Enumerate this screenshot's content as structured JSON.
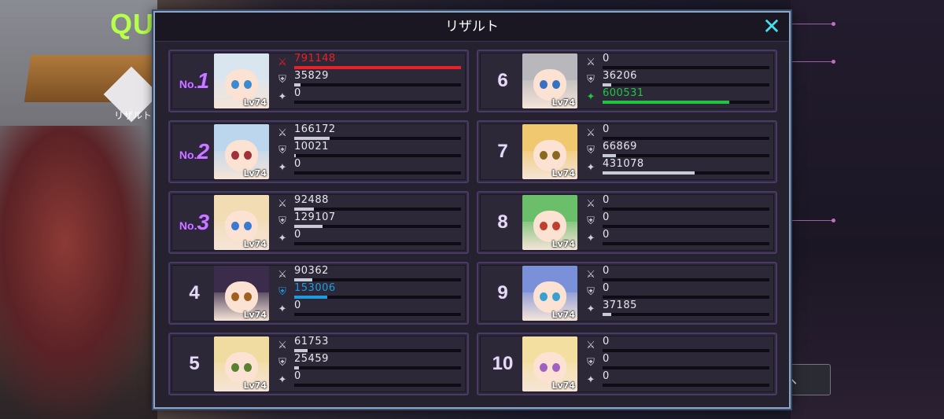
{
  "background": {
    "quest_title": "QU",
    "result_label": "リザルト",
    "next_button": "へ"
  },
  "modal": {
    "title": "リザルト",
    "close_symbol": "✕"
  },
  "colors": {
    "damage_top": "#e8202a",
    "heal_top": "#21c443",
    "guard_top": "#1e9ce0",
    "bar_default": "#c9cad7",
    "rank_top": "#c77cff",
    "close": "#46e0e8"
  },
  "stat_icons": [
    "sword-icon",
    "shield-icon",
    "sparkle-icon"
  ],
  "players": [
    {
      "rank": "1",
      "top": true,
      "level": "Lv74",
      "hair": "#d9e6ef",
      "eyes": "#3c8ad0",
      "stats": [
        {
          "value": "791148",
          "fill": 1.0,
          "highlight": "damage"
        },
        {
          "value": "35829",
          "fill": 0.04
        },
        {
          "value": "0",
          "fill": 0
        }
      ]
    },
    {
      "rank": "2",
      "top": true,
      "level": "Lv74",
      "hair": "#bcd6ee",
      "eyes": "#a0303a",
      "stats": [
        {
          "value": "166172",
          "fill": 0.21
        },
        {
          "value": "10021",
          "fill": 0.01
        },
        {
          "value": "0",
          "fill": 0
        }
      ]
    },
    {
      "rank": "3",
      "top": true,
      "level": "Lv74",
      "hair": "#f1dcb4",
      "eyes": "#3a7ad0",
      "stats": [
        {
          "value": "92488",
          "fill": 0.12
        },
        {
          "value": "129107",
          "fill": 0.17
        },
        {
          "value": "0",
          "fill": 0
        }
      ]
    },
    {
      "rank": "4",
      "top": false,
      "level": "Lv74",
      "hair": "#3a2c4a",
      "eyes": "#a06020",
      "stats": [
        {
          "value": "90362",
          "fill": 0.11
        },
        {
          "value": "153006",
          "fill": 0.2,
          "highlight": "guard"
        },
        {
          "value": "0",
          "fill": 0
        }
      ]
    },
    {
      "rank": "5",
      "top": false,
      "level": "Lv74",
      "hair": "#f0dca0",
      "eyes": "#5a8030",
      "stats": [
        {
          "value": "61753",
          "fill": 0.08
        },
        {
          "value": "25459",
          "fill": 0.03
        },
        {
          "value": "0",
          "fill": 0
        }
      ]
    },
    {
      "rank": "6",
      "top": false,
      "level": "Lv74",
      "hair": "#b8b8bc",
      "eyes": "#3a70c0",
      "stats": [
        {
          "value": "0",
          "fill": 0
        },
        {
          "value": "36206",
          "fill": 0.05
        },
        {
          "value": "600531",
          "fill": 0.76,
          "highlight": "heal"
        }
      ]
    },
    {
      "rank": "7",
      "top": false,
      "level": "Lv74",
      "hair": "#f0c870",
      "eyes": "#8a6a20",
      "stats": [
        {
          "value": "0",
          "fill": 0
        },
        {
          "value": "66869",
          "fill": 0.08
        },
        {
          "value": "431078",
          "fill": 0.55
        }
      ]
    },
    {
      "rank": "8",
      "top": false,
      "level": "Lv74",
      "hair": "#6cbf6a",
      "eyes": "#c04030",
      "stats": [
        {
          "value": "0",
          "fill": 0
        },
        {
          "value": "0",
          "fill": 0
        },
        {
          "value": "0",
          "fill": 0
        }
      ]
    },
    {
      "rank": "9",
      "top": false,
      "level": "Lv74",
      "hair": "#7a90d8",
      "eyes": "#3aa0d0",
      "stats": [
        {
          "value": "0",
          "fill": 0
        },
        {
          "value": "0",
          "fill": 0
        },
        {
          "value": "37185",
          "fill": 0.05
        }
      ]
    },
    {
      "rank": "10",
      "top": false,
      "level": "Lv74",
      "hair": "#f3e0a0",
      "eyes": "#a060c0",
      "stats": [
        {
          "value": "0",
          "fill": 0
        },
        {
          "value": "0",
          "fill": 0
        },
        {
          "value": "0",
          "fill": 0
        }
      ]
    }
  ]
}
